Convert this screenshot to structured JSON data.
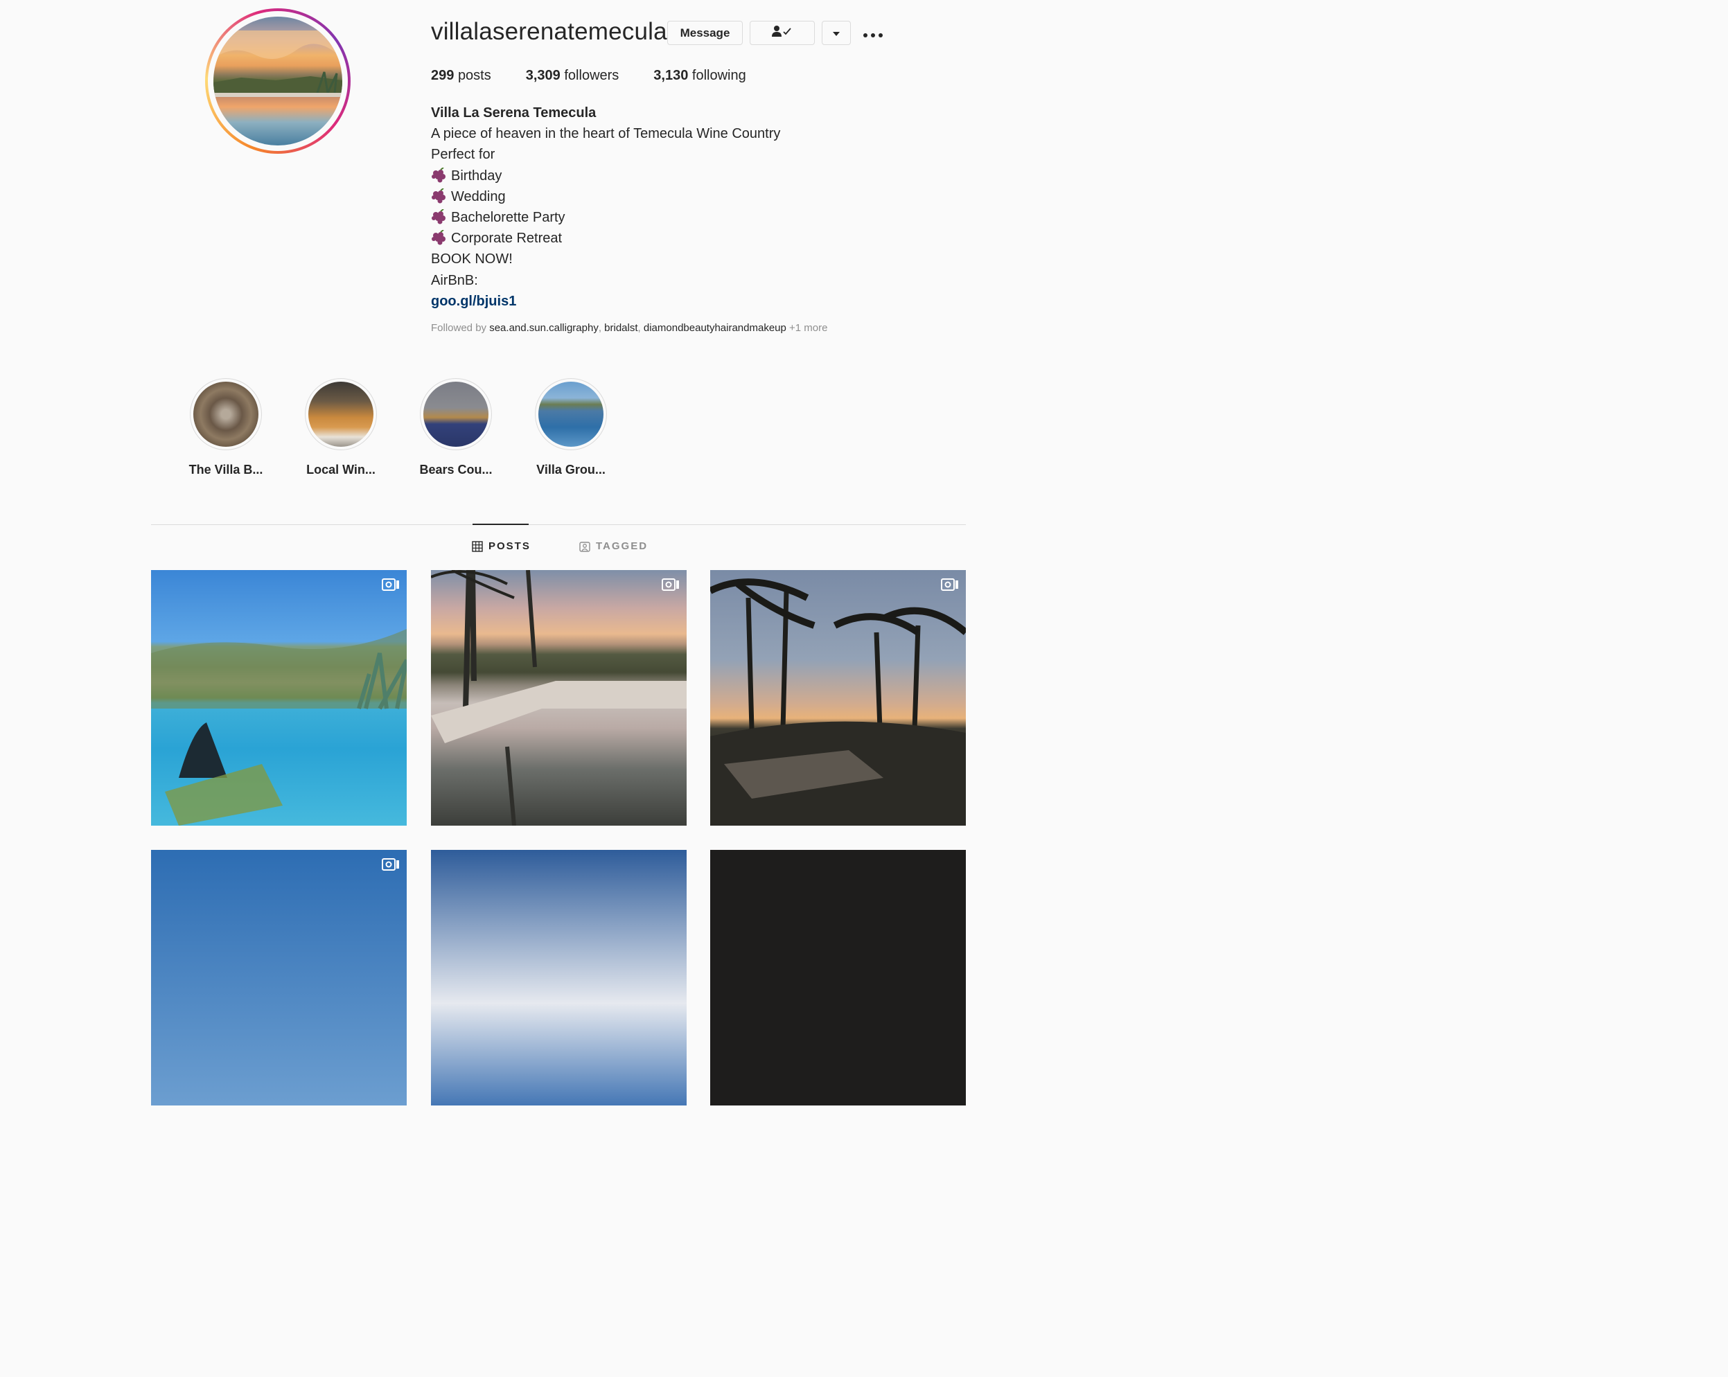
{
  "profile": {
    "username": "villalaserenatemecula",
    "message_label": "Message",
    "stats": {
      "posts_count": "299",
      "posts_label": "posts",
      "followers_count": "3,309",
      "followers_label": "followers",
      "following_count": "3,130",
      "following_label": "following"
    },
    "bio": {
      "full_name": "Villa La Serena Temecula",
      "tagline": "A piece of heaven in the heart of Temecula Wine Country",
      "perfect_for": "Perfect for",
      "items": [
        "Birthday",
        "Wedding",
        "Bachelorette Party",
        "Corporate Retreat"
      ],
      "cta": "BOOK NOW!",
      "airbnb": "AirBnB:",
      "link": "goo.gl/bjuis1"
    },
    "followed_by": {
      "prefix": "Followed by",
      "users": [
        "sea.and.sun.calligraphy",
        "bridalst",
        "diamondbeautyhairandmakeup"
      ],
      "more": "+1 more"
    }
  },
  "highlights": [
    {
      "label": "The Villa B..."
    },
    {
      "label": "Local Win..."
    },
    {
      "label": "Bears Cou..."
    },
    {
      "label": "Villa Grou..."
    }
  ],
  "tabs": {
    "posts": "POSTS",
    "tagged": "TAGGED"
  },
  "icons": {
    "following": "person-check-icon",
    "dropdown": "caret-down-icon",
    "more": "ellipsis-icon",
    "posts_tab": "grid-icon",
    "tagged_tab": "tag-person-icon",
    "post_type": "igtv-video-icon",
    "bio_bullet": "grapes-emoji"
  },
  "colors": {
    "link": "#003569",
    "muted": "#8e8e8e",
    "border": "#dbdbdb",
    "text": "#262626"
  }
}
